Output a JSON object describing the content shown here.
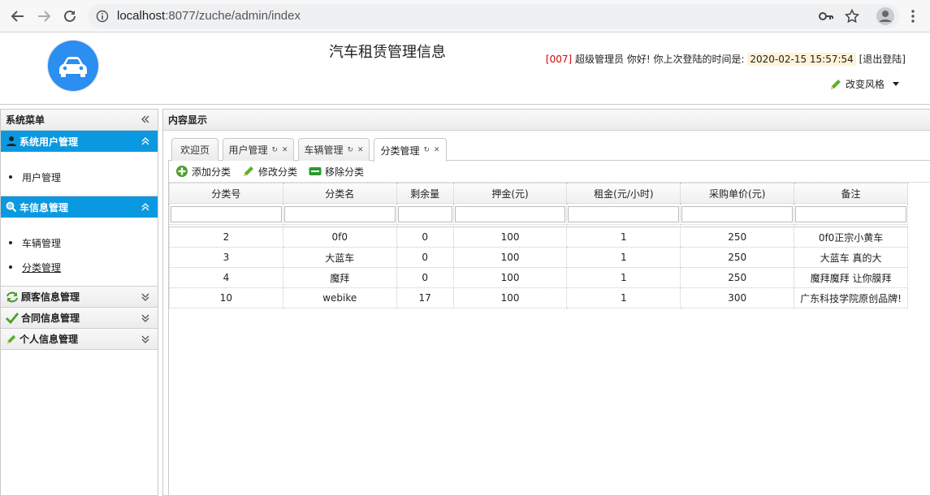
{
  "browser": {
    "url_host": "localhost",
    "url_rest": ":8077/zuche/admin/index"
  },
  "header": {
    "title": "汽车租赁管理信息",
    "user_id": "[007]",
    "user_greeting": " 超级管理员 你好! 你上次登陆的时间是:",
    "last_login": "2020-02-15 15:57:54",
    "logout": "[退出登陆]",
    "change_style": "改变风格"
  },
  "sidebar": {
    "title": "系统菜单",
    "groups": [
      {
        "label": "系统用户管理",
        "items": [
          "用户管理"
        ]
      },
      {
        "label": "车信息管理",
        "items": [
          "车辆管理",
          "分类管理"
        ]
      },
      {
        "label": "顾客信息管理"
      },
      {
        "label": "合同信息管理"
      },
      {
        "label": "个人信息管理"
      }
    ]
  },
  "content": {
    "title": "内容显示",
    "tabs": [
      "欢迎页",
      "用户管理",
      "车辆管理",
      "分类管理"
    ],
    "toolbar": {
      "add": "添加分类",
      "edit": "修改分类",
      "remove": "移除分类"
    },
    "columns": [
      "分类号",
      "分类名",
      "剩余量",
      "押金(元)",
      "租金(元/小时)",
      "采购单价(元)",
      "备注"
    ],
    "rows": [
      [
        "2",
        "0f0",
        "0",
        "100",
        "1",
        "250",
        "0f0正宗小黄车"
      ],
      [
        "3",
        "大蓝车",
        "0",
        "100",
        "1",
        "250",
        "大蓝车 真的大"
      ],
      [
        "4",
        "魔拜",
        "0",
        "100",
        "1",
        "250",
        "魔拜魔拜 让你膜拜"
      ],
      [
        "10",
        "webike",
        "17",
        "100",
        "1",
        "300",
        "广东科技学院原创品牌!"
      ]
    ]
  },
  "colors": {
    "accent": "#0a99e0",
    "logo": "#2b8ef0",
    "user_id": "#dd0000"
  }
}
